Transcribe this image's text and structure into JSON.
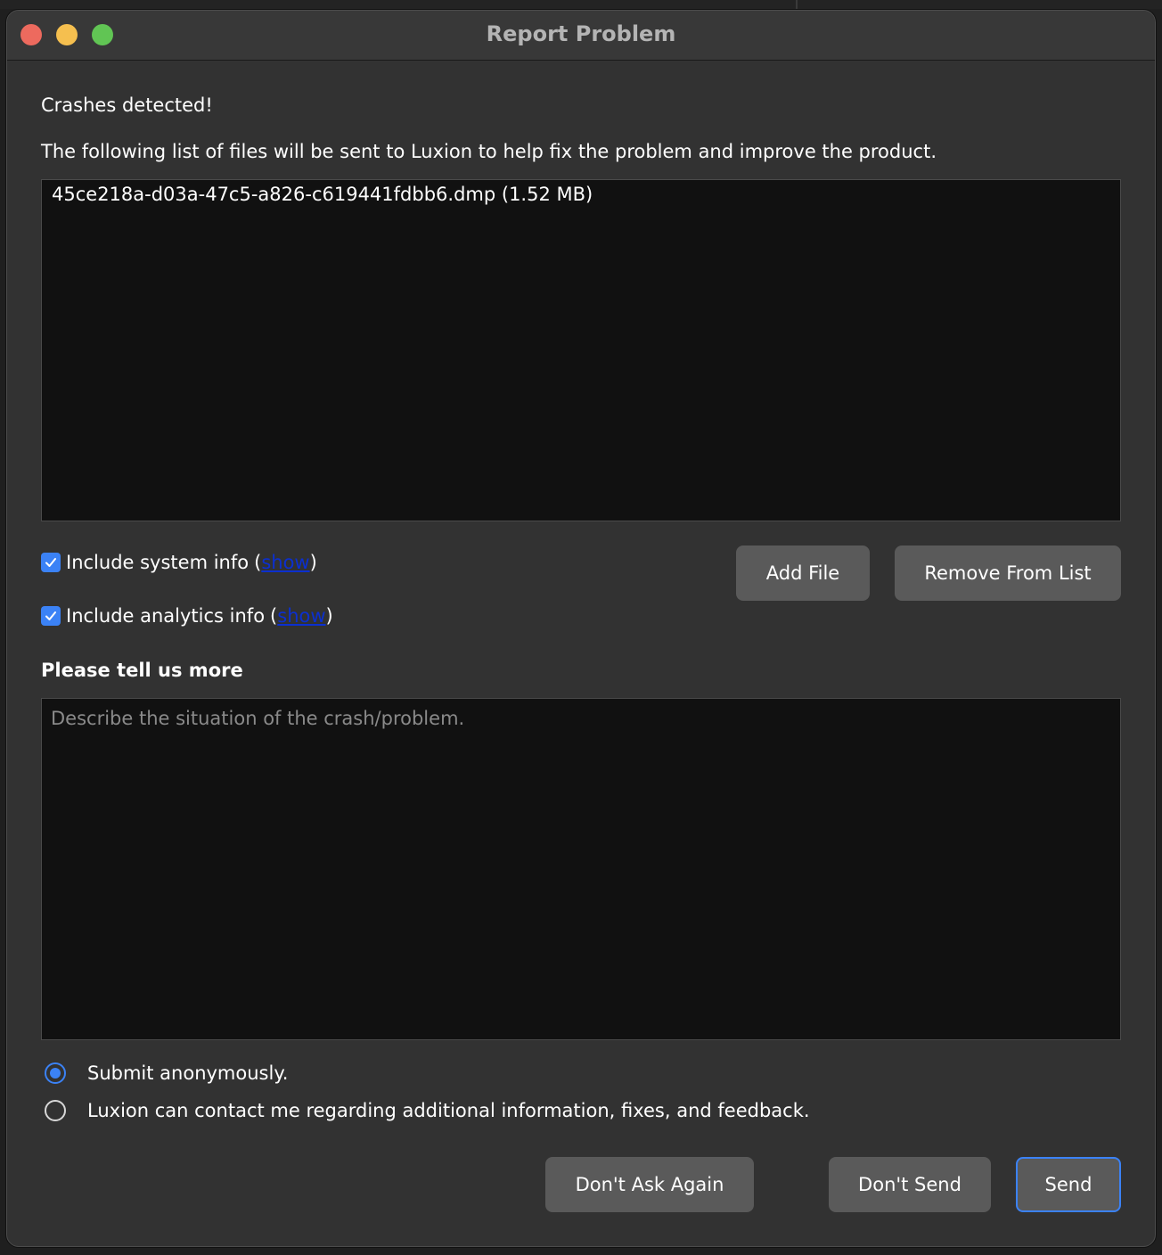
{
  "window": {
    "title": "Report Problem"
  },
  "content": {
    "heading": "Crashes detected!",
    "description": "The following list of files will be sent to Luxion to help fix the problem and improve the product.",
    "files": [
      "45ce218a-d03a-47c5-a826-c619441fdbb6.dmp (1.52 MB)"
    ],
    "include_system_info": {
      "label": "Include system info",
      "checked": true,
      "link": "show"
    },
    "include_analytics_info": {
      "label": "Include analytics info",
      "checked": true,
      "link": "show"
    },
    "add_file_label": "Add File",
    "remove_from_list_label": "Remove From List",
    "tell_more_heading": "Please tell us more",
    "description_field": {
      "value": "",
      "placeholder": "Describe the situation of the crash/problem."
    },
    "contact_options": [
      {
        "label": "Submit anonymously.",
        "selected": true
      },
      {
        "label": "Luxion can contact me regarding additional information, fixes, and feedback.",
        "selected": false
      }
    ]
  },
  "footer": {
    "dont_ask_again_label": "Don't Ask Again",
    "dont_send_label": "Don't Send",
    "send_label": "Send"
  },
  "colors": {
    "accent": "#3b82f6",
    "link": "#0b2fd0",
    "window_bg": "#323232",
    "field_bg": "#111111",
    "button_bg": "#5a5a5a"
  }
}
